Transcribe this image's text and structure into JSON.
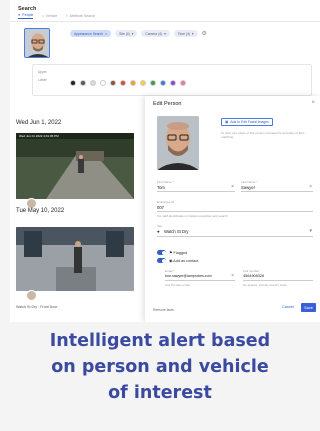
{
  "search": {
    "title": "Search",
    "tabs": [
      {
        "label": "People"
      },
      {
        "label": "Vehicle"
      },
      {
        "label": "Attribute Search"
      }
    ],
    "chips": [
      {
        "label": "Appearance Search"
      },
      {
        "label": "Site (4)"
      },
      {
        "label": "Camera (4)"
      },
      {
        "label": "Time (4)"
      }
    ],
    "filters": {
      "labels": [
        "Upper",
        "Lower"
      ],
      "swatch_colors": [
        "#222222",
        "#5a5a5a",
        "#d9d9d9",
        "#ffffff",
        "#8b5a2b",
        "#d94a3a",
        "#f0a030",
        "#f2d03a",
        "#3aa04a",
        "#3a7be0",
        "#8a4ad0",
        "#e57ab0"
      ]
    }
  },
  "events": [
    {
      "date": "Wed Jun 1, 2022",
      "overlay": "Wed Jun 01 2022  4:01:05 PM",
      "caption": ""
    },
    {
      "date": "Tue May 10, 2022",
      "overlay": "",
      "caption": "Watch St Dry · Front Door"
    }
  ],
  "modal": {
    "title": "Edit Person",
    "add_button": "Add to Edit Facial Images",
    "add_help": "To help your photo of this person increase the accuracy of face matching.",
    "first_name": {
      "label": "First Name *",
      "value": "Tom"
    },
    "last_name": {
      "label": "Last Name *",
      "value": "Sawyer"
    },
    "employee_id": {
      "label": "Employee ID",
      "value": "007"
    },
    "employee_help": "For staff identification in facial recognition and search",
    "site": {
      "label": "Site",
      "value": "Watch St Dry"
    },
    "flagged_label": "Flagged",
    "contact_label": "Add as contact",
    "email": {
      "label": "Email *",
      "value": "tom.sawyer@lamprobes.com"
    },
    "email_help": "Use Primary email",
    "phone": {
      "label": "Cell number",
      "value": "4564908326"
    },
    "phone_help": "No spaces, include country code",
    "remove_link": "Remove facts",
    "cancel": "Cancel",
    "save": "Save"
  },
  "caption": {
    "line1": "Intelligent alert based",
    "line2": "on person and vehicle",
    "line3": "of interest"
  }
}
